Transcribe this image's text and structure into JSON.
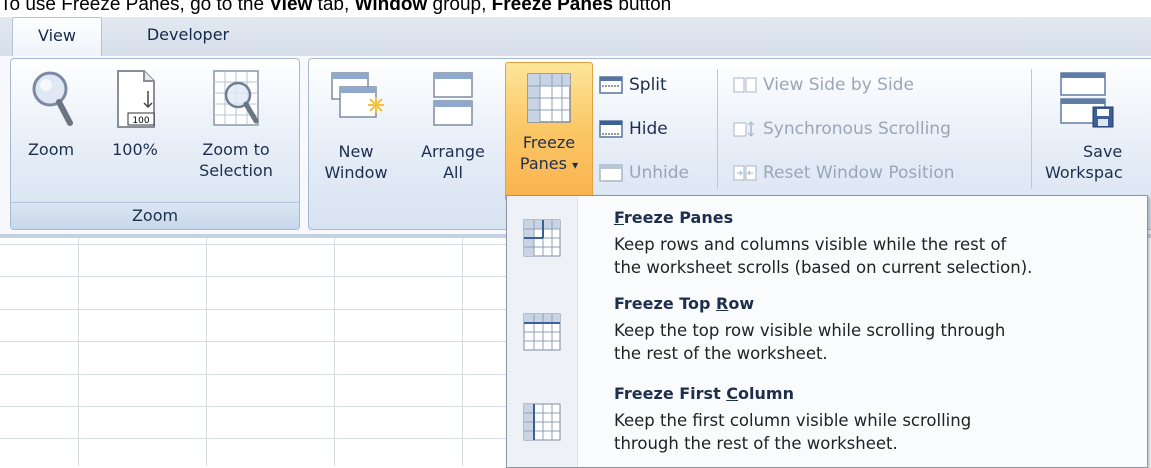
{
  "instruction": {
    "prefix": "To use Freeze Panes, go to the ",
    "tab_bold": "View",
    "mid1": " tab, ",
    "group_bold": "Window",
    "mid2": " group, ",
    "button_bold": "Freeze Panes",
    "suffix": " button"
  },
  "tabs": [
    {
      "label": "View",
      "active": true
    },
    {
      "label": "Developer",
      "active": false
    }
  ],
  "zoom_group": {
    "label": "Zoom",
    "buttons": {
      "zoom": "Zoom",
      "hundred": "100%",
      "hundred_badge": "100",
      "zoom_sel_1": "Zoom to",
      "zoom_sel_2": "Selection"
    }
  },
  "window_group": {
    "new_window_1": "New",
    "new_window_2": "Window",
    "arrange_1": "Arrange",
    "arrange_2": "All",
    "freeze_1": "Freeze",
    "freeze_2": "Panes",
    "freeze_arrow": "▾",
    "split": "Split",
    "hide": "Hide",
    "unhide": "Unhide",
    "side_by_side": "View Side by Side",
    "sync_scroll": "Synchronous Scrolling",
    "reset_pos": "Reset Window Position",
    "save_1": "Save",
    "save_2": "Workspac"
  },
  "freeze_menu": [
    {
      "title_pre": "",
      "title_u": "F",
      "title_post": "reeze Panes",
      "desc1": "Keep rows and columns visible while the rest of",
      "desc2": "the worksheet scrolls (based on current selection)."
    },
    {
      "title_pre": "Freeze Top ",
      "title_u": "R",
      "title_post": "ow",
      "desc1": "Keep the top row visible while scrolling through",
      "desc2": "the rest of the worksheet."
    },
    {
      "title_pre": "Freeze First ",
      "title_u": "C",
      "title_post": "olumn",
      "desc1": "Keep the first column visible while scrolling",
      "desc2": "through the rest of the worksheet."
    }
  ],
  "colors": {
    "accent_highlight": "#f9b24d",
    "ribbon_border": "#a7b9d2",
    "text": "#1d2f4d"
  }
}
